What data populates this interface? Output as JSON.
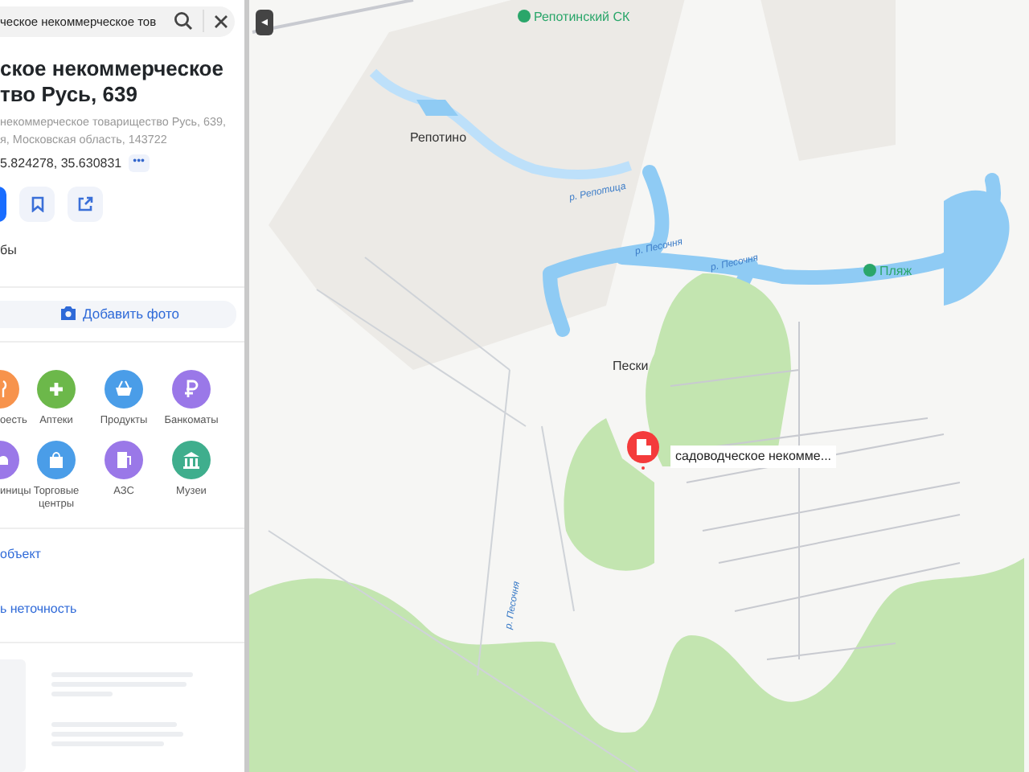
{
  "search": {
    "value": "ческое некоммерческое тов"
  },
  "collapse": {
    "glyph": "◂"
  },
  "place": {
    "title": "ское некоммерческое\nтво Русь, 639",
    "address": "некоммерческое товарищество Русь, 639,\nя, Московская область, 143722",
    "coordinates": "5.824278, 35.630831",
    "more": "•••"
  },
  "actions": [
    {
      "kind": "primary"
    },
    {
      "kind": "bookmark"
    },
    {
      "kind": "share"
    }
  ],
  "section_label": "бы",
  "add_photo": "Добавить фото",
  "categories": [
    {
      "label": "оесть",
      "color": "#f7934c",
      "kind": "food"
    },
    {
      "label": "Аптеки",
      "color": "#6cb84a",
      "kind": "pharmacy"
    },
    {
      "label": "Продукты",
      "color": "#4a9de8",
      "kind": "grocery"
    },
    {
      "label": "Банкоматы",
      "color": "#9a78e8",
      "kind": "atm"
    },
    {
      "label": "иницы",
      "color": "#9a78e8",
      "kind": "hotel"
    },
    {
      "label": "Торговые\nцентры",
      "color": "#4a9de8",
      "kind": "mall"
    },
    {
      "label": "АЗС",
      "color": "#9a78e8",
      "kind": "fuel"
    },
    {
      "label": "Музеи",
      "color": "#3fae8d",
      "kind": "museum"
    }
  ],
  "links": [
    "объект",
    "ь неточность"
  ],
  "map": {
    "labels": [
      {
        "text": "Репотинский СК",
        "kind": "poi"
      },
      {
        "text": "Репотино",
        "kind": "town"
      },
      {
        "text": "р. Репотица",
        "kind": "river"
      },
      {
        "text": "р. Песочня",
        "kind": "river"
      },
      {
        "text": "р. Песочня",
        "kind": "river"
      },
      {
        "text": "Пляж",
        "kind": "poi"
      },
      {
        "text": "Пески",
        "kind": "town"
      },
      {
        "text": "садоводческое некомме...",
        "kind": "marker"
      },
      {
        "text": "р. Песочня",
        "kind": "river"
      }
    ]
  }
}
